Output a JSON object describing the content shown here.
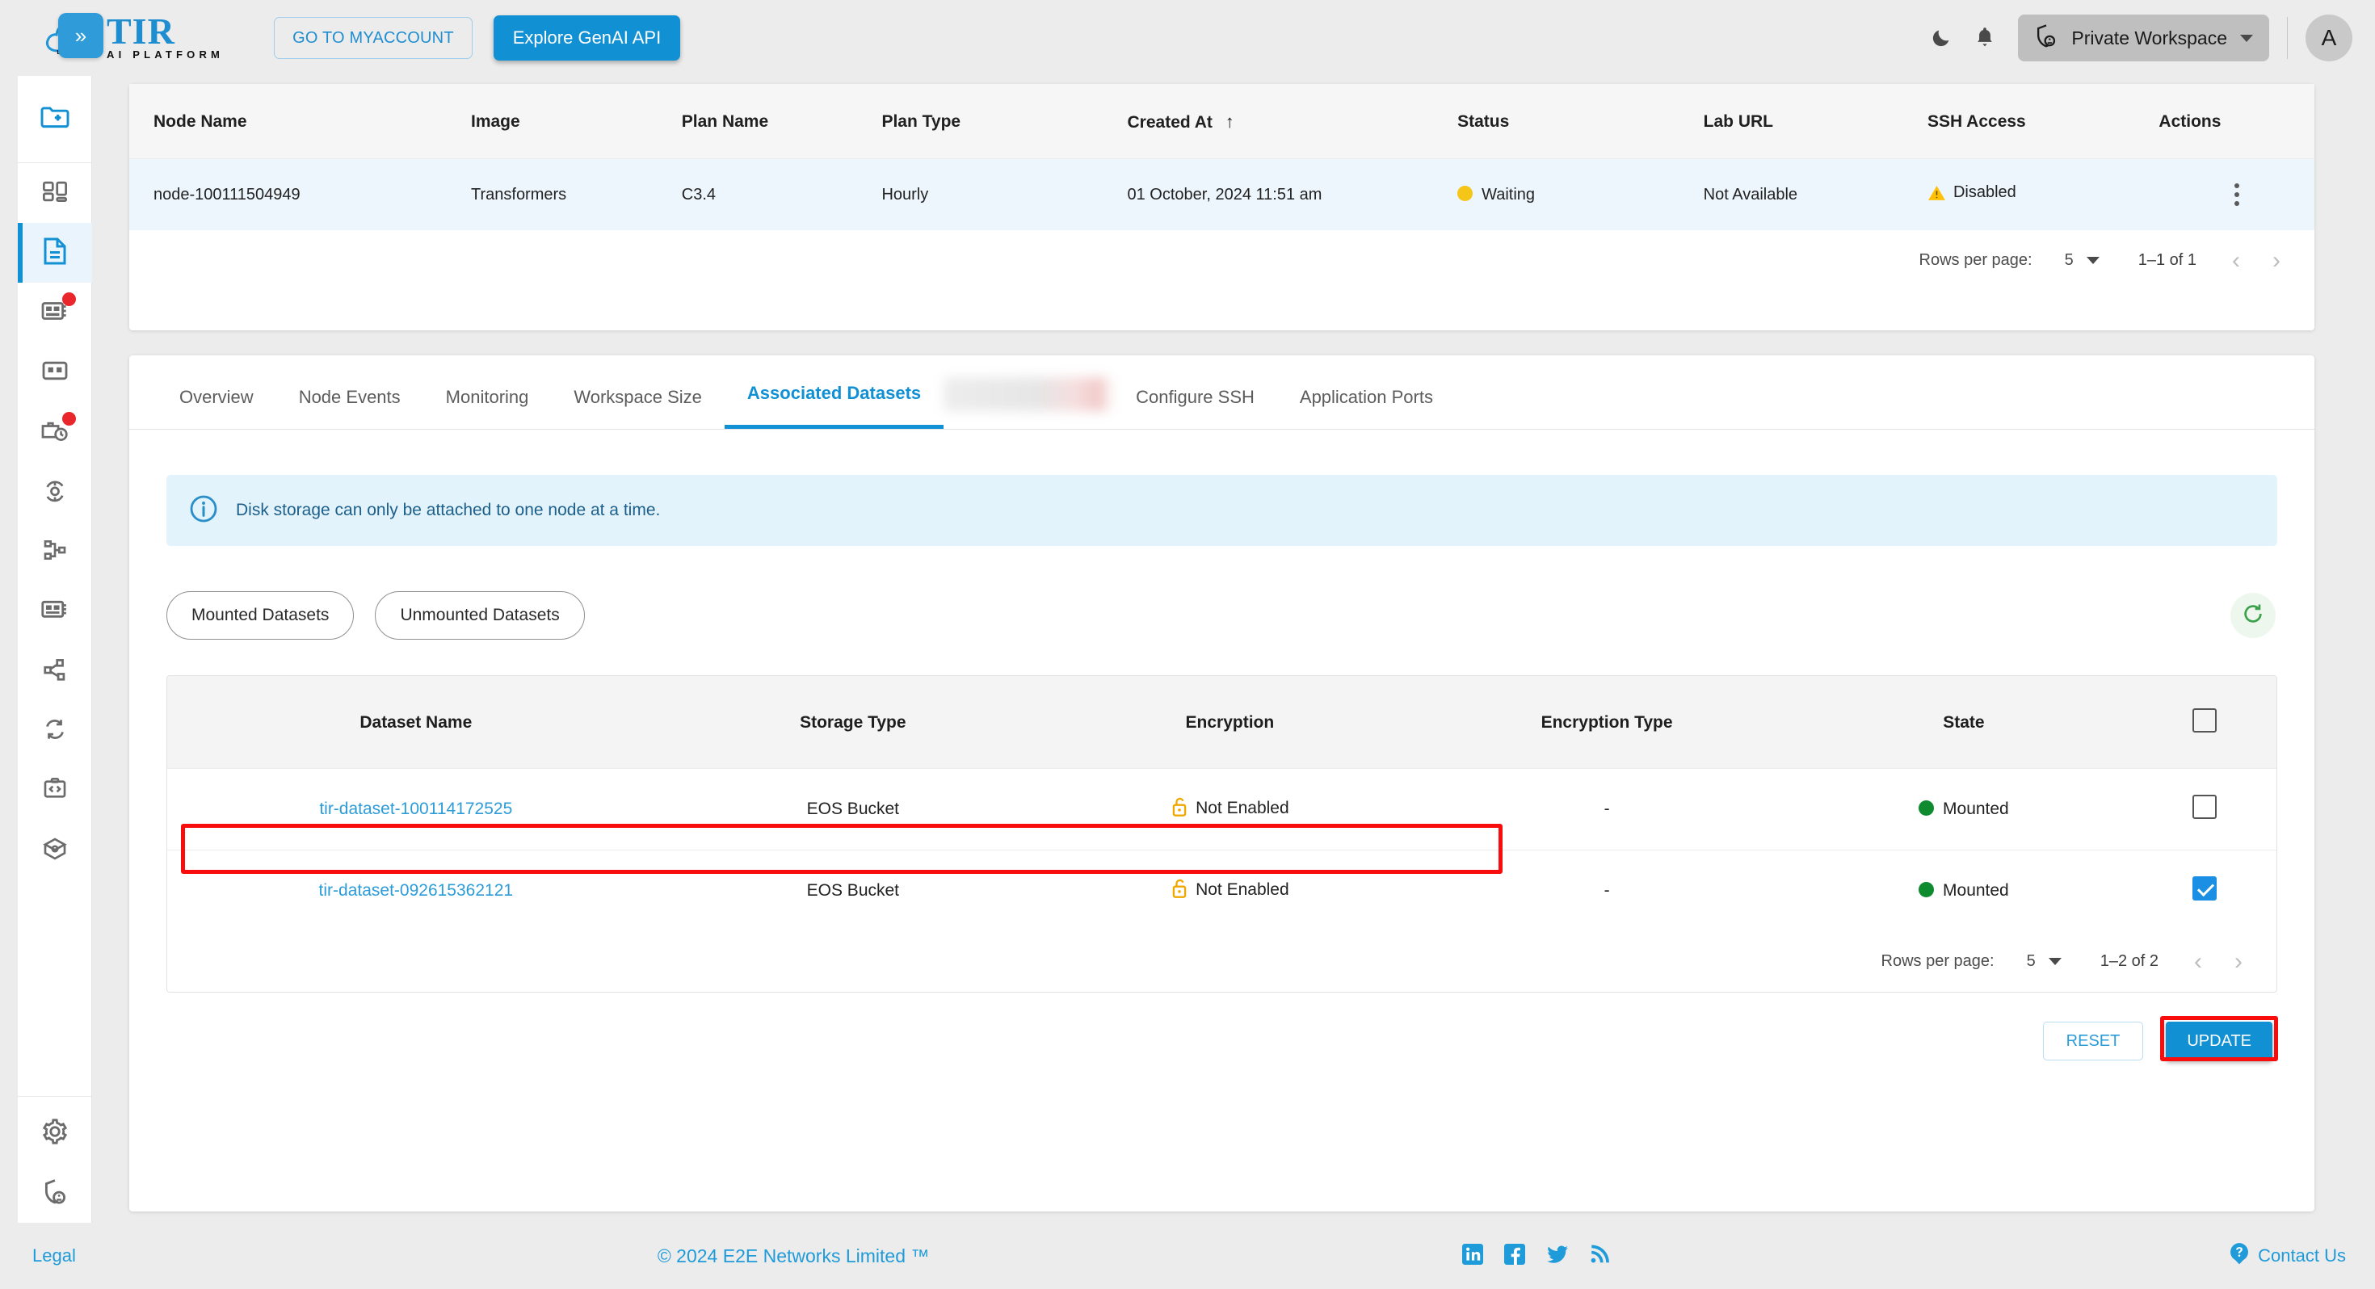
{
  "brand": {
    "name": "TIR",
    "subtitle": "AI PLATFORM",
    "cloud_badge": "E2E Cloud"
  },
  "header": {
    "myaccount_label": "GO TO MYACCOUNT",
    "genai_label": "Explore GenAI API",
    "dark_mode_icon": "moon-icon",
    "notification_icon": "bell-icon",
    "workspace_label": "Private Workspace",
    "workspace_icon": "shield-user-icon",
    "avatar_initial": "A"
  },
  "sidebar": {
    "collapse_icon": "double-chevron-right-icon",
    "items": [
      {
        "name": "new-folder-icon",
        "badge": false
      },
      {
        "name": "dashboard-grid-icon",
        "badge": false
      },
      {
        "name": "notebook-document-icon",
        "badge": false,
        "active": true
      },
      {
        "name": "gpu-card-icon",
        "badge": true
      },
      {
        "name": "grid-panel-icon",
        "badge": false
      },
      {
        "name": "briefcase-clock-icon",
        "badge": true
      },
      {
        "name": "model-sync-icon",
        "badge": false
      },
      {
        "name": "pipeline-nodes-icon",
        "badge": false
      },
      {
        "name": "memory-chip-icon",
        "badge": false
      },
      {
        "name": "share-network-icon",
        "badge": false
      },
      {
        "name": "refresh-sync-icon",
        "badge": false
      },
      {
        "name": "code-clipboard-icon",
        "badge": false
      },
      {
        "name": "package-box-icon",
        "badge": false
      },
      {
        "name": "settings-gear-icon",
        "badge": false
      },
      {
        "name": "shield-user-icon",
        "badge": false
      }
    ]
  },
  "node_table": {
    "columns": [
      "Node Name",
      "Image",
      "Plan Name",
      "Plan Type",
      "Created At",
      "Status",
      "Lab URL",
      "SSH Access",
      "Actions"
    ],
    "sort_column": "Created At",
    "sort_direction_icon": "arrow-up-icon",
    "rows": [
      {
        "node_name": "node-100111504949",
        "image": "Transformers",
        "plan_name": "C3.4",
        "plan_type": "Hourly",
        "created_at": "01 October, 2024 11:51 am",
        "status": "Waiting",
        "status_color": "#f5c518",
        "lab_url": "Not Available",
        "ssh_access": "Disabled",
        "ssh_icon": "warning-triangle-icon",
        "actions_icon": "kebab-menu-icon"
      }
    ],
    "pagination": {
      "rows_per_page_label": "Rows per page:",
      "rows_per_page_value": "5",
      "range": "1–1 of 1",
      "prev_icon": "chevron-left-icon",
      "next_icon": "chevron-right-icon"
    }
  },
  "tabs": [
    {
      "label": "Overview",
      "active": false,
      "blurred": false
    },
    {
      "label": "Node Events",
      "active": false,
      "blurred": false
    },
    {
      "label": "Monitoring",
      "active": false,
      "blurred": false
    },
    {
      "label": "Workspace Size",
      "active": false,
      "blurred": false
    },
    {
      "label": "Associated Datasets",
      "active": true,
      "blurred": false
    },
    {
      "label": "",
      "active": false,
      "blurred": true
    },
    {
      "label": "Configure SSH",
      "active": false,
      "blurred": false
    },
    {
      "label": "Application Ports",
      "active": false,
      "blurred": false
    }
  ],
  "info_banner": {
    "icon": "info-circle-icon",
    "text": "Disk storage can only be attached to one node at a time."
  },
  "filters": {
    "chips": [
      {
        "label": "Mounted Datasets",
        "selected": false
      },
      {
        "label": "Unmounted Datasets",
        "selected": false
      }
    ],
    "refresh_icon": "refresh-icon"
  },
  "dataset_table": {
    "columns": [
      "Dataset Name",
      "Storage Type",
      "Encryption",
      "Encryption Type",
      "State",
      ""
    ],
    "select_all_checked": false,
    "rows": [
      {
        "dataset_name": "tir-dataset-100114172525",
        "storage_type": "EOS Bucket",
        "encryption": "Not Enabled",
        "encryption_icon": "unlock-icon",
        "encryption_type": "-",
        "state": "Mounted",
        "state_color": "#0e8a2f",
        "checked": false,
        "highlighted": true
      },
      {
        "dataset_name": "tir-dataset-092615362121",
        "storage_type": "EOS Bucket",
        "encryption": "Not Enabled",
        "encryption_icon": "unlock-icon",
        "encryption_type": "-",
        "state": "Mounted",
        "state_color": "#0e8a2f",
        "checked": true,
        "highlighted": false
      }
    ],
    "pagination": {
      "rows_per_page_label": "Rows per page:",
      "rows_per_page_value": "5",
      "range": "1–2 of 2",
      "prev_icon": "chevron-left-icon",
      "next_icon": "chevron-right-icon"
    }
  },
  "actions": {
    "reset_label": "RESET",
    "update_label": "UPDATE"
  },
  "footer": {
    "legal": "Legal",
    "copyright": "© 2024 E2E Networks Limited ™",
    "social": [
      "linkedin-icon",
      "facebook-icon",
      "twitter-icon",
      "rss-icon"
    ],
    "contact_label": "Contact Us",
    "contact_icon": "question-circle-icon"
  },
  "colors": {
    "accent": "#1290d4",
    "link": "#2c9cd8",
    "highlight": "#f90c0c",
    "warning": "#f5c518",
    "success": "#0e8a2f",
    "page_bg": "#ececec"
  }
}
